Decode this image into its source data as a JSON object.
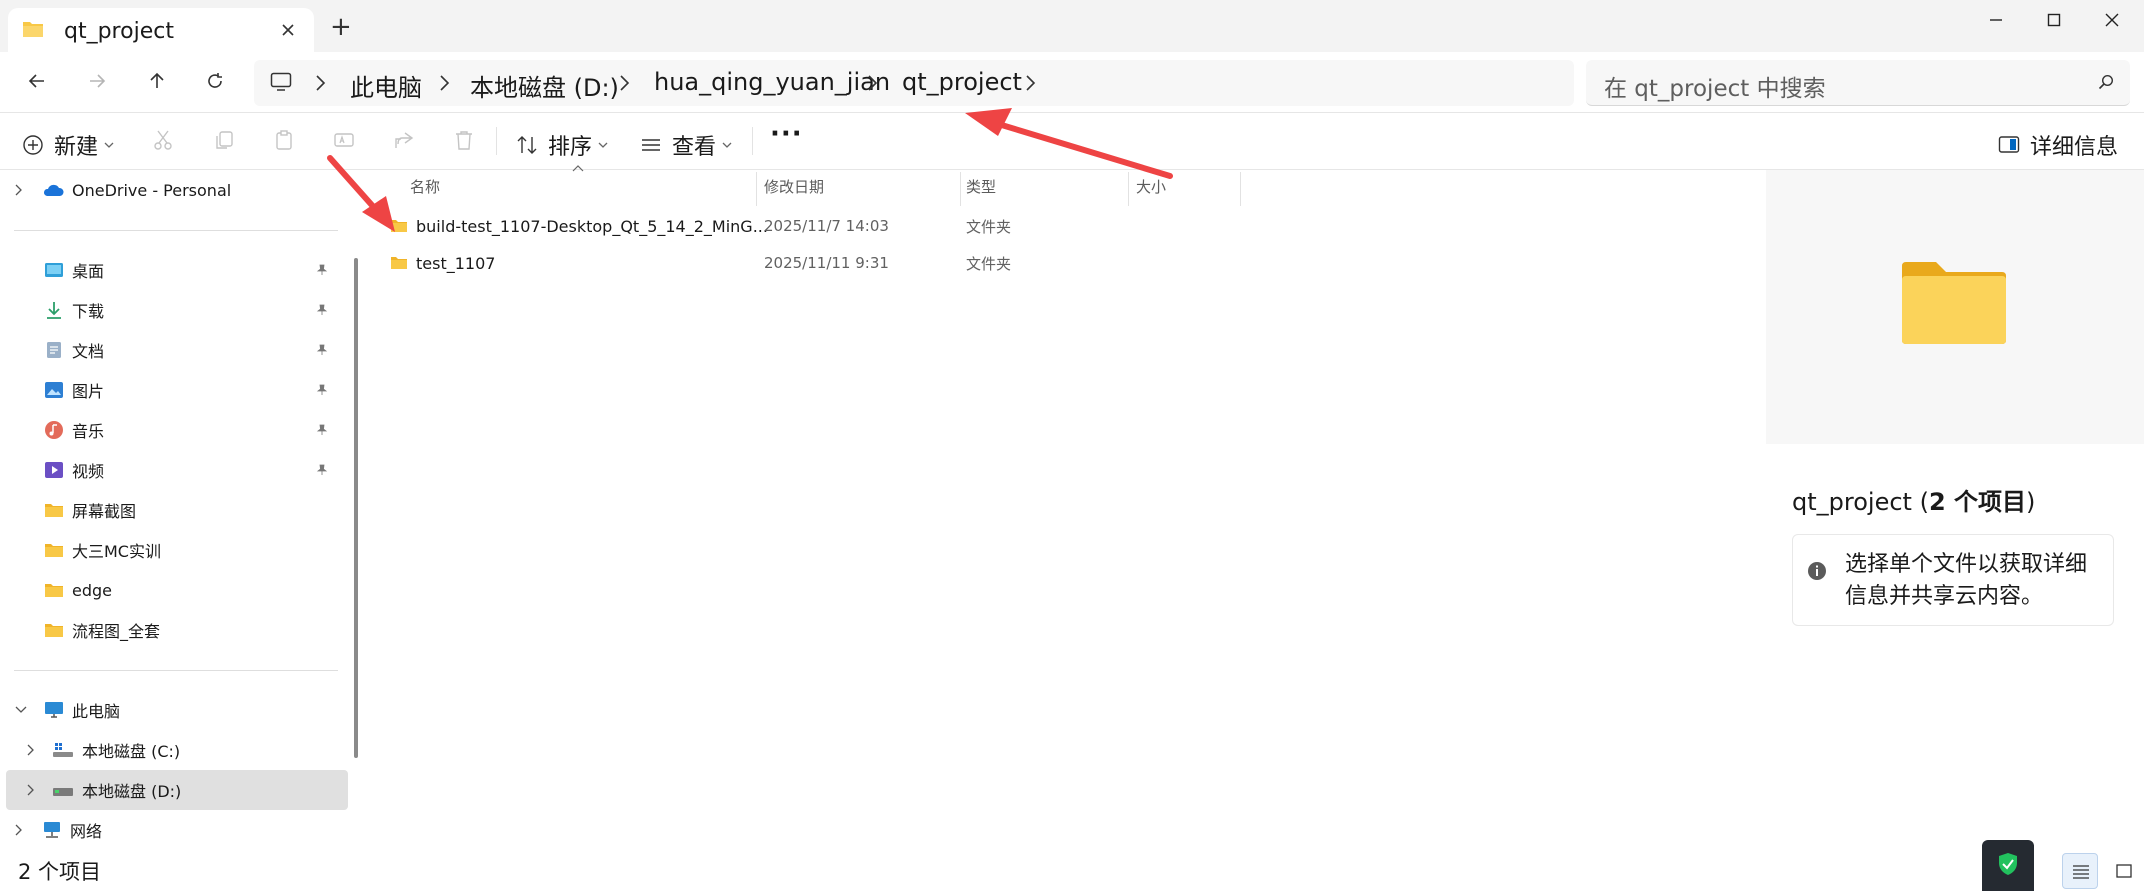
{
  "window": {
    "tab_title": "qt_project",
    "new_tab_label": "+",
    "tab_icon": "folder-icon",
    "close_tab_icon": "close-icon",
    "controls": [
      "minimize-icon",
      "maximize-icon",
      "close-icon"
    ]
  },
  "nav": {
    "buttons": [
      "back-arrow-icon",
      "forward-arrow-icon",
      "up-arrow-icon",
      "refresh-icon"
    ],
    "breadcrumb": [
      "此电脑",
      "本地磁盘 (D:)",
      "hua_qing_yuan_jian",
      "qt_project"
    ],
    "computer_icon": "monitor-icon",
    "search_placeholder": "在 qt_project 中搜索"
  },
  "toolbar": {
    "new_label": "新建",
    "sort_label": "排序",
    "view_label": "查看",
    "more_label": "···",
    "details_label": "详细信息",
    "disabled_icons": [
      "cut-icon",
      "copy-icon",
      "paste-icon",
      "rename-icon",
      "share-icon",
      "delete-icon"
    ]
  },
  "sidebar": {
    "onedrive": "OneDrive - Personal",
    "quick_access": [
      {
        "label": "桌面",
        "icon": "desktop-icon",
        "pinned": true
      },
      {
        "label": "下载",
        "icon": "download-icon",
        "pinned": true
      },
      {
        "label": "文档",
        "icon": "document-icon",
        "pinned": true
      },
      {
        "label": "图片",
        "icon": "picture-icon",
        "pinned": true
      },
      {
        "label": "音乐",
        "icon": "music-icon",
        "pinned": true
      },
      {
        "label": "视频",
        "icon": "video-icon",
        "pinned": true
      },
      {
        "label": "屏幕截图",
        "icon": "folder-icon",
        "pinned": false
      },
      {
        "label": "大三MC实训",
        "icon": "folder-icon",
        "pinned": false
      },
      {
        "label": "edge",
        "icon": "folder-icon",
        "pinned": false
      },
      {
        "label": "流程图_全套",
        "icon": "folder-icon",
        "pinned": false
      }
    ],
    "this_pc": "此电脑",
    "drive_c": "本地磁盘 (C:)",
    "drive_d": "本地磁盘 (D:)",
    "network": "网络"
  },
  "file_list": {
    "columns": [
      "名称",
      "修改日期",
      "类型",
      "大小"
    ],
    "rows": [
      {
        "name": "build-test_1107-Desktop_Qt_5_14_2_MinG...",
        "modified": "2025/11/7 14:03",
        "type": "文件夹",
        "size": ""
      },
      {
        "name": "test_1107",
        "modified": "2025/11/11 9:31",
        "type": "文件夹",
        "size": ""
      }
    ]
  },
  "details": {
    "title_prefix": "qt_project (",
    "title_count": "2 个项目",
    "title_suffix": ")",
    "info_text": "选择单个文件以获取详细信息并共享云内容。",
    "info_icon": "info-icon"
  },
  "status": {
    "item_count": "2 个项目"
  },
  "colors": {
    "accent": "#0067c0",
    "folder_yellow": "#f8c846",
    "annotation_red": "#ee4444",
    "selection_gray": "#e0e0e0"
  }
}
